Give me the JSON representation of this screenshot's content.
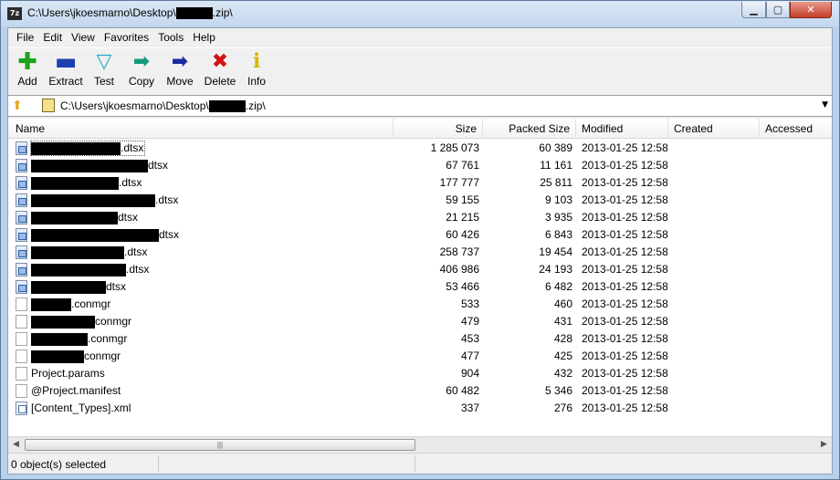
{
  "window": {
    "title_prefix": "C:\\Users\\jkoesmarno\\Desktop\\",
    "title_suffix": ".zip\\",
    "app_icon_label": "7z",
    "minimize_icon": "minimize-icon",
    "maximize_icon": "maximize-icon",
    "close_icon": "close-icon"
  },
  "menu": [
    "File",
    "Edit",
    "View",
    "Favorites",
    "Tools",
    "Help"
  ],
  "toolbar": {
    "add": {
      "label": "Add",
      "icon": "plus-icon",
      "color": "#1aa31a"
    },
    "extract": {
      "label": "Extract",
      "icon": "minus-icon",
      "color": "#1c3fb0"
    },
    "test": {
      "label": "Test",
      "icon": "check-icon",
      "color": "#27a7c9"
    },
    "copy": {
      "label": "Copy",
      "icon": "copy-arrow-icon",
      "color": "#159a7a"
    },
    "move": {
      "label": "Move",
      "icon": "move-arrow-icon",
      "color": "#1c2c9e"
    },
    "delete": {
      "label": "Delete",
      "icon": "x-icon",
      "color": "#d41414"
    },
    "info": {
      "label": "Info",
      "icon": "info-icon",
      "color": "#d6b800"
    }
  },
  "address": {
    "prefix": "C:\\Users\\jkoesmarno\\Desktop\\",
    "suffix": ".zip\\"
  },
  "columns": {
    "name": "Name",
    "size": "Size",
    "packed": "Packed Size",
    "modified": "Modified",
    "created": "Created",
    "accessed": "Accessed"
  },
  "files": [
    {
      "type": "dtsx",
      "suffix": ".dtsx",
      "size": "1 285 073",
      "packed": "60 389",
      "modified": "2013-01-25 12:58"
    },
    {
      "type": "dtsx",
      "suffix": "dtsx",
      "size": "67 761",
      "packed": "11 161",
      "modified": "2013-01-25 12:58"
    },
    {
      "type": "dtsx",
      "suffix": ".dtsx",
      "size": "177 777",
      "packed": "25 811",
      "modified": "2013-01-25 12:58"
    },
    {
      "type": "dtsx",
      "suffix": ".dtsx",
      "size": "59 155",
      "packed": "9 103",
      "modified": "2013-01-25 12:58"
    },
    {
      "type": "dtsx",
      "suffix": "dtsx",
      "size": "21 215",
      "packed": "3 935",
      "modified": "2013-01-25 12:58"
    },
    {
      "type": "dtsx",
      "suffix": "dtsx",
      "size": "60 426",
      "packed": "6 843",
      "modified": "2013-01-25 12:58"
    },
    {
      "type": "dtsx",
      "suffix": ".dtsx",
      "size": "258 737",
      "packed": "19 454",
      "modified": "2013-01-25 12:58"
    },
    {
      "type": "dtsx",
      "suffix": ".dtsx",
      "size": "406 986",
      "packed": "24 193",
      "modified": "2013-01-25 12:58"
    },
    {
      "type": "dtsx",
      "suffix": "dtsx",
      "size": "53 466",
      "packed": "6 482",
      "modified": "2013-01-25 12:58"
    },
    {
      "type": "plain",
      "suffix": ".conmgr",
      "size": "533",
      "packed": "460",
      "modified": "2013-01-25 12:58"
    },
    {
      "type": "plain",
      "suffix": "conmgr",
      "size": "479",
      "packed": "431",
      "modified": "2013-01-25 12:58"
    },
    {
      "type": "plain",
      "suffix": ".conmgr",
      "size": "453",
      "packed": "428",
      "modified": "2013-01-25 12:58"
    },
    {
      "type": "plain",
      "suffix": "conmgr",
      "size": "477",
      "packed": "425",
      "modified": "2013-01-25 12:58"
    },
    {
      "type": "plain",
      "name": "Project.params",
      "size": "904",
      "packed": "432",
      "modified": "2013-01-25 12:58"
    },
    {
      "type": "plain",
      "name": "@Project.manifest",
      "size": "60 482",
      "packed": "5 346",
      "modified": "2013-01-25 12:58"
    },
    {
      "type": "xml",
      "name": "[Content_Types].xml",
      "size": "337",
      "packed": "276",
      "modified": "2013-01-25 12:58"
    }
  ],
  "status": {
    "selection": "0 object(s) selected"
  }
}
